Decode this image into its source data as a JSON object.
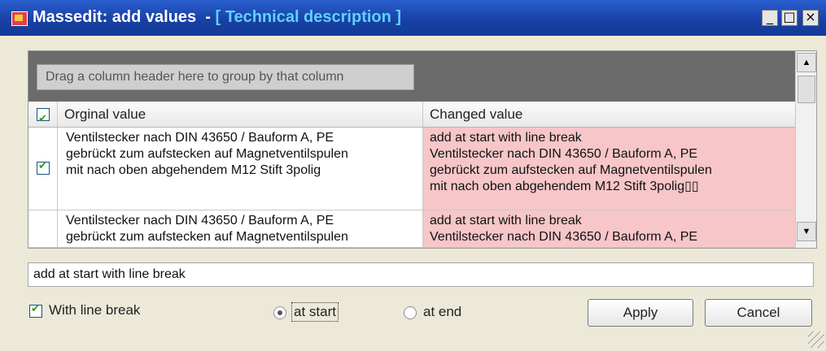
{
  "window": {
    "title_prefix": "Massedit: add values  - ",
    "title_bracket": "[ Technical description ]",
    "buttons": {
      "minimize": "_",
      "maximize": "□",
      "close": "×"
    }
  },
  "grid": {
    "group_panel_text": "Drag a column header here to group by that column",
    "columns": [
      "Orginal value",
      "Changed value"
    ],
    "rows": [
      {
        "original": [
          "Ventilstecker nach DIN 43650 / Bauform A, PE",
          "gebrückt zum aufstecken auf Magnetventilspulen",
          "mit nach oben abgehendem M12 Stift 3polig"
        ],
        "changed": [
          "add at start with line break",
          "Ventilstecker nach DIN 43650 / Bauform A, PE",
          "gebrückt zum aufstecken auf Magnetventilspulen",
          "mit nach oben abgehendem M12 Stift 3polig▯▯"
        ],
        "checked": true
      },
      {
        "original": [
          "Ventilstecker nach DIN 43650 / Bauform A, PE",
          "gebrückt zum aufstecken auf Magnetventilspulen"
        ],
        "changed": [
          "add at start with line break",
          "Ventilstecker nach DIN 43650 / Bauform A, PE"
        ],
        "checked": false
      }
    ]
  },
  "input": {
    "value": "add at start with line break"
  },
  "options": {
    "line_break_label": "With line break",
    "at_start_label": "at start",
    "at_end_label": "at end",
    "selected": "at start"
  },
  "actions": {
    "apply_label": "Apply",
    "cancel_label": "Cancel"
  },
  "icons": {
    "checkbox": "checkmark-icon",
    "scroll_up": "scroll-up-arrow-icon",
    "scroll_down": "scroll-down-arrow-icon"
  },
  "colors": {
    "title_bar": "#1941a5",
    "changed_cell": "#f6c6c9",
    "grid_background": "#6b6b6b"
  }
}
